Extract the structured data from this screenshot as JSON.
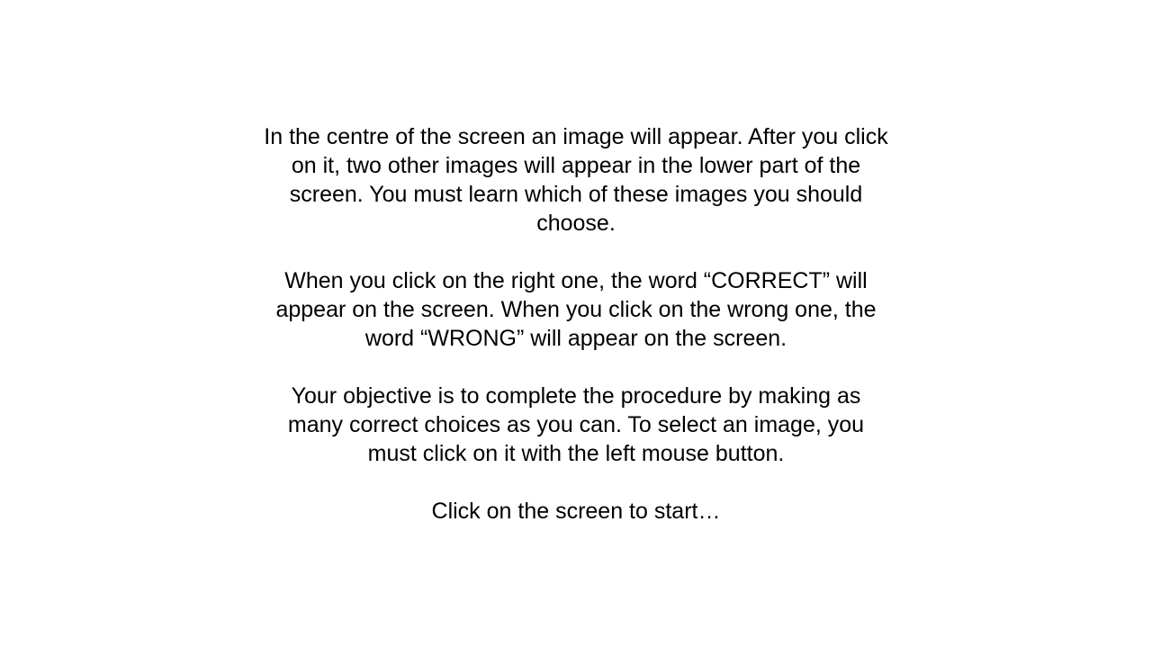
{
  "instructions": {
    "paragraph_1": "In the centre of the screen an image will appear. After you click on it, two other images will appear in the lower part of the screen. You must learn which of these images you should choose.",
    "paragraph_2": "When you click on the right one, the word “CORRECT” will appear on the screen. When you click on the wrong one, the word “WRONG” will appear on the screen.",
    "paragraph_3": "Your objective is to complete the procedure by making as many correct choices as you can. To select an image, you must click on it with the left mouse button.",
    "start_prompt": "Click on the screen to start…"
  }
}
